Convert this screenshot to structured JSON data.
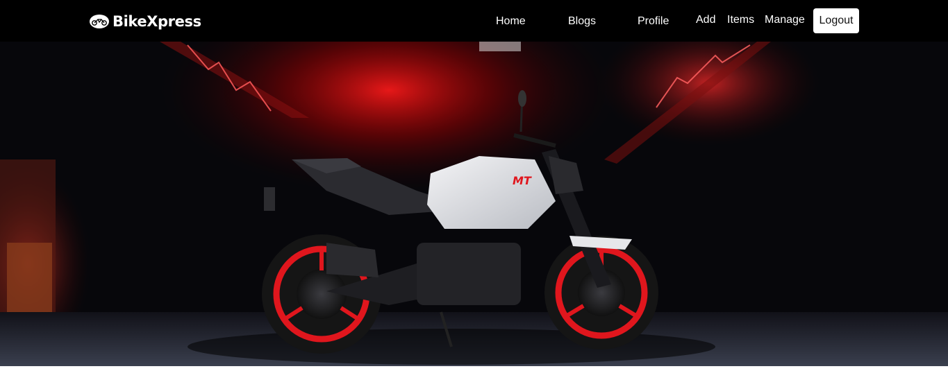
{
  "brand": {
    "name": "BikeXpress",
    "icon": "motorbike-logo-icon"
  },
  "nav": {
    "home": "Home",
    "blogs": "Blogs",
    "profile": "Profile",
    "add": "Add",
    "items": "Items",
    "manage": "Manage",
    "logout": "Logout"
  },
  "hero": {
    "image_subject": "white and black naked sport motorcycle with red wheels in a dark red-lit garage",
    "tank_badge": "MT"
  },
  "colors": {
    "navbar_bg": "#000000",
    "accent_red": "#e0161d",
    "text_light": "#ffffff",
    "logout_bg": "#ffffff"
  }
}
